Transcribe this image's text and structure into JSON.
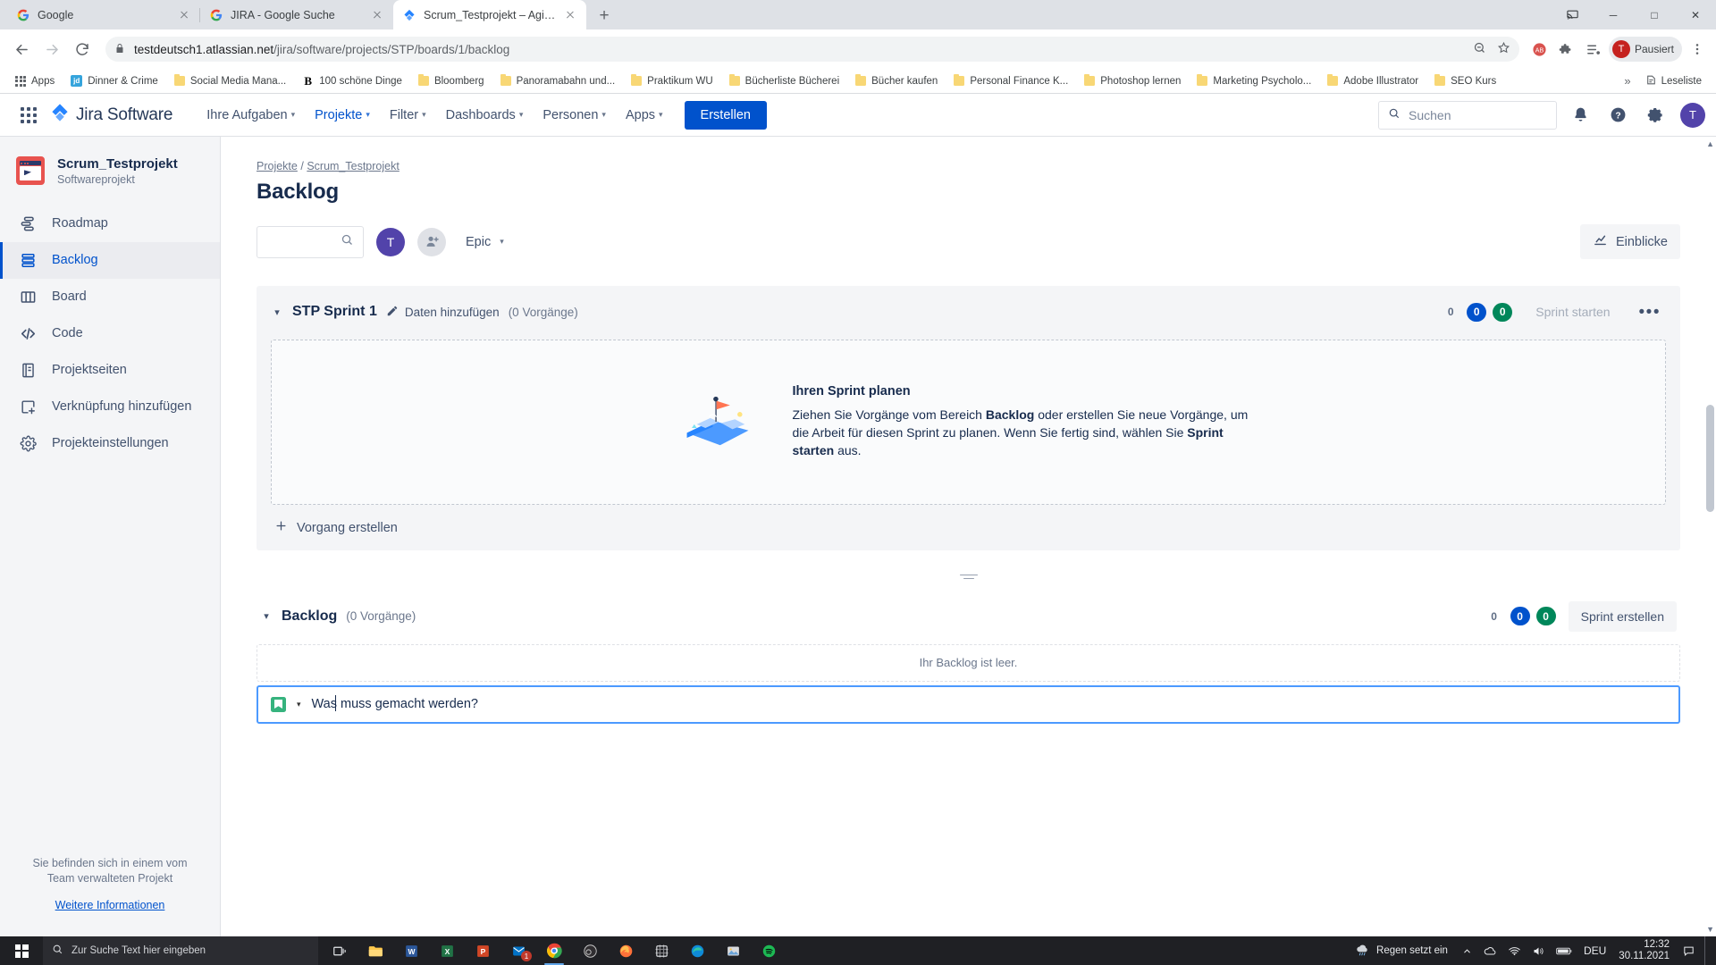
{
  "browser": {
    "tabs": [
      {
        "title": "Google",
        "favicon": "google-icon",
        "active": false
      },
      {
        "title": "JIRA - Google Suche",
        "favicon": "google-icon",
        "active": false
      },
      {
        "title": "Scrum_Testprojekt – Agile-Board",
        "favicon": "jira-icon",
        "active": true
      }
    ],
    "new_tab_label": "+",
    "window_controls": {
      "minimize": "─",
      "maximize": "□",
      "close": "✕",
      "cast": "cast-icon"
    },
    "address": {
      "host": "testdeutsch1.atlassian.net",
      "path": "/jira/software/projects/STP/boards/1/backlog",
      "lock": "lock-icon"
    },
    "profile_label": "Pausiert",
    "profile_initial": "T",
    "bookmarks": [
      {
        "label": "Apps",
        "icon": "apps-grid-icon"
      },
      {
        "label": "Dinner & Crime",
        "icon": "jd-icon"
      },
      {
        "label": "Social Media Mana...",
        "icon": "folder-icon"
      },
      {
        "label": "100 schöne Dinge",
        "icon": "b-icon"
      },
      {
        "label": "Bloomberg",
        "icon": "folder-icon"
      },
      {
        "label": "Panoramabahn und...",
        "icon": "folder-icon"
      },
      {
        "label": "Praktikum WU",
        "icon": "folder-icon"
      },
      {
        "label": "Bücherliste Bücherei",
        "icon": "folder-icon"
      },
      {
        "label": "Bücher kaufen",
        "icon": "folder-icon"
      },
      {
        "label": "Personal Finance K...",
        "icon": "folder-icon"
      },
      {
        "label": "Photoshop lernen",
        "icon": "folder-icon"
      },
      {
        "label": "Marketing Psycholo...",
        "icon": "folder-icon"
      },
      {
        "label": "Adobe Illustrator",
        "icon": "folder-icon"
      },
      {
        "label": "SEO Kurs",
        "icon": "folder-icon"
      }
    ],
    "bookmarks_overflow": "»",
    "reading_list": "Leseliste"
  },
  "jira": {
    "product_name": "Jira Software",
    "nav_items": [
      {
        "label": "Ihre Aufgaben",
        "has_caret": true,
        "active": false
      },
      {
        "label": "Projekte",
        "has_caret": true,
        "active": true
      },
      {
        "label": "Filter",
        "has_caret": true,
        "active": false
      },
      {
        "label": "Dashboards",
        "has_caret": true,
        "active": false
      },
      {
        "label": "Personen",
        "has_caret": true,
        "active": false
      },
      {
        "label": "Apps",
        "has_caret": true,
        "active": false
      }
    ],
    "create_button": "Erstellen",
    "search_placeholder": "Suchen",
    "nav_icons": [
      "notifications-bell-icon",
      "help-question-icon",
      "settings-gear-icon"
    ],
    "avatar_initial": "T",
    "accent_color": "#0052cc"
  },
  "sidebar": {
    "project_name": "Scrum_Testprojekt",
    "project_type": "Softwareprojekt",
    "items": [
      {
        "label": "Roadmap",
        "icon": "roadmap-icon",
        "active": false
      },
      {
        "label": "Backlog",
        "icon": "backlog-icon",
        "active": true
      },
      {
        "label": "Board",
        "icon": "board-columns-icon",
        "active": false
      },
      {
        "label": "Code",
        "icon": "code-brackets-icon",
        "active": false
      },
      {
        "label": "Projektseiten",
        "icon": "pages-icon",
        "active": false
      },
      {
        "label": "Verknüpfung hinzufügen",
        "icon": "add-shortcut-icon",
        "active": false
      },
      {
        "label": "Projekteinstellungen",
        "icon": "project-settings-gear-icon",
        "active": false
      }
    ],
    "footer_text": "Sie befinden sich in einem vom Team verwalteten Projekt",
    "footer_link": "Weitere Informationen"
  },
  "content": {
    "breadcrumb_projects": "Projekte",
    "breadcrumb_sep": "/",
    "breadcrumb_project": "Scrum_Testprojekt",
    "page_title": "Backlog",
    "filter": {
      "search_value": "",
      "avatar_initial": "T",
      "add_people_icon": "add-person-icon",
      "epic_label": "Epic",
      "insights_label": "Einblicke"
    },
    "sprint": {
      "name": "STP Sprint 1",
      "add_dates": "Daten hinzufügen",
      "issue_count": "(0 Vorgänge)",
      "pills": {
        "todo": "0",
        "inprogress": "0",
        "done": "0"
      },
      "start_button": "Sprint starten",
      "more_button": "•••",
      "empty_title": "Ihren Sprint planen",
      "empty_desc_1": "Ziehen Sie Vorgänge vom Bereich ",
      "empty_desc_bold_1": "Backlog",
      "empty_desc_2": " oder erstellen Sie neue Vorgänge, um die Arbeit für diesen Sprint zu planen. Wenn Sie fertig sind, wählen Sie ",
      "empty_desc_bold_2": "Sprint starten",
      "empty_desc_3": " aus.",
      "create_issue": "Vorgang erstellen"
    },
    "backlog": {
      "name": "Backlog",
      "issue_count": "(0 Vorgänge)",
      "pills": {
        "todo": "0",
        "inprogress": "0",
        "done": "0"
      },
      "create_sprint_button": "Sprint erstellen",
      "empty_text": "Ihr Backlog ist leer.",
      "new_issue_value": "Was muss gemacht werden?",
      "new_issue_type_icon": "story-type-icon"
    }
  },
  "taskbar": {
    "search_placeholder": "Zur Suche Text hier eingeben",
    "apps": [
      {
        "name": "task-view-icon",
        "badge": ""
      },
      {
        "name": "file-explorer-icon",
        "badge": ""
      },
      {
        "name": "word-icon",
        "badge": ""
      },
      {
        "name": "excel-icon",
        "badge": ""
      },
      {
        "name": "powerpoint-icon",
        "badge": ""
      },
      {
        "name": "outlook-icon",
        "badge": "1"
      },
      {
        "name": "chrome-icon",
        "badge": ""
      },
      {
        "name": "obs-icon",
        "badge": ""
      },
      {
        "name": "firefox-icon",
        "badge": ""
      },
      {
        "name": "snip-icon",
        "badge": ""
      },
      {
        "name": "edge-icon",
        "badge": ""
      },
      {
        "name": "photos-icon",
        "badge": ""
      },
      {
        "name": "spotify-icon",
        "badge": ""
      }
    ],
    "weather": "Regen setzt ein",
    "language": "DEU",
    "time": "12:32",
    "date": "30.11.2021"
  }
}
